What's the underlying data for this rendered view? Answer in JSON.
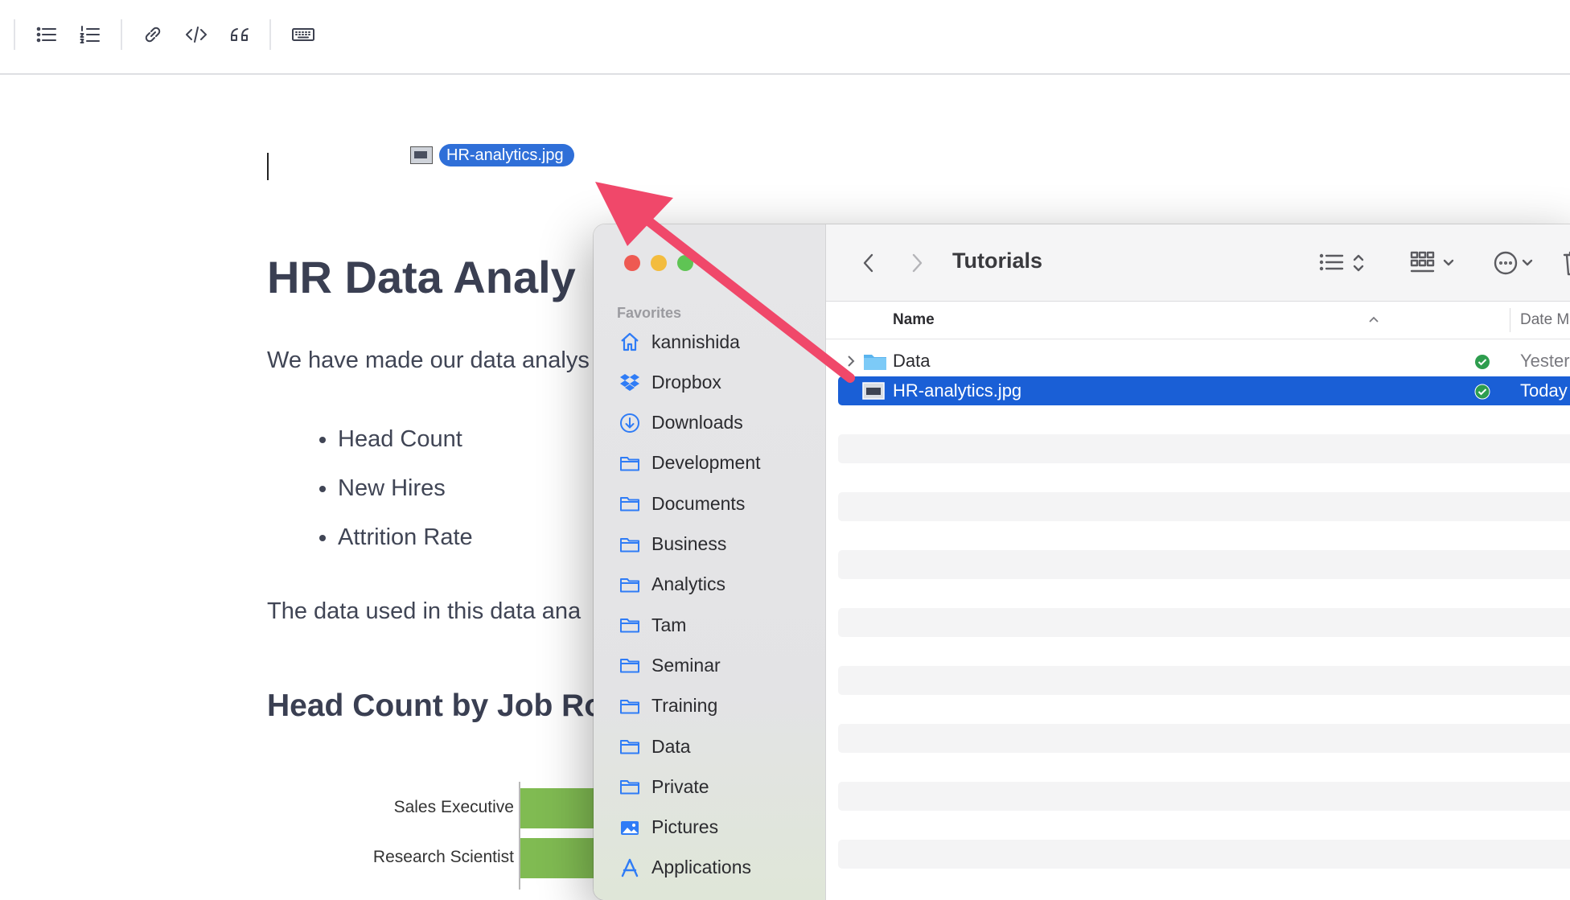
{
  "toolbar": {
    "buttons": [
      {
        "name": "bulleted-list-icon"
      },
      {
        "name": "numbered-list-icon"
      },
      {
        "name": "link-icon"
      },
      {
        "name": "code-icon"
      },
      {
        "name": "quote-icon"
      },
      {
        "name": "keyboard-icon"
      }
    ]
  },
  "drag": {
    "filename": "HR-analytics.jpg"
  },
  "document": {
    "title": "HR Data Analy",
    "intro": "We have made our data analys",
    "bullets": [
      "Head Count",
      "New Hires",
      "Attrition Rate"
    ],
    "data_text": "The data used in this data ana",
    "section_heading": "Head Count by Job Ro"
  },
  "chart_data": {
    "type": "bar",
    "orientation": "horizontal",
    "categories": [
      "Sales Executive",
      "Research Scientist"
    ],
    "color": "#80bb52"
  },
  "finder": {
    "title": "Tutorials",
    "sidebar": {
      "section": "Favorites",
      "items": [
        {
          "label": "kannishida",
          "icon": "home-icon"
        },
        {
          "label": "Dropbox",
          "icon": "dropbox-icon"
        },
        {
          "label": "Downloads",
          "icon": "download-icon"
        },
        {
          "label": "Development",
          "icon": "folder-icon"
        },
        {
          "label": "Documents",
          "icon": "folder-icon"
        },
        {
          "label": "Business",
          "icon": "folder-icon"
        },
        {
          "label": "Analytics",
          "icon": "folder-icon"
        },
        {
          "label": "Tam",
          "icon": "folder-icon"
        },
        {
          "label": "Seminar",
          "icon": "folder-icon"
        },
        {
          "label": "Training",
          "icon": "folder-icon"
        },
        {
          "label": "Data",
          "icon": "folder-icon"
        },
        {
          "label": "Private",
          "icon": "folder-icon"
        },
        {
          "label": "Pictures",
          "icon": "pictures-icon"
        },
        {
          "label": "Applications",
          "icon": "applications-icon"
        }
      ]
    },
    "columns": {
      "name": "Name",
      "date": "Date M"
    },
    "rows": [
      {
        "name": "Data",
        "date": "Yester",
        "kind": "folder",
        "selected": false
      },
      {
        "name": "HR-analytics.jpg",
        "date": "Today",
        "kind": "image",
        "selected": true
      }
    ]
  },
  "colors": {
    "accent": "#1a5fd6",
    "drag_label": "#2f6fd8",
    "arrow": "#f0486a",
    "sync_ok": "#2e9d4e",
    "traffic_close": "#ee5a52",
    "traffic_min": "#f3bc3e",
    "traffic_max": "#5fc454"
  }
}
